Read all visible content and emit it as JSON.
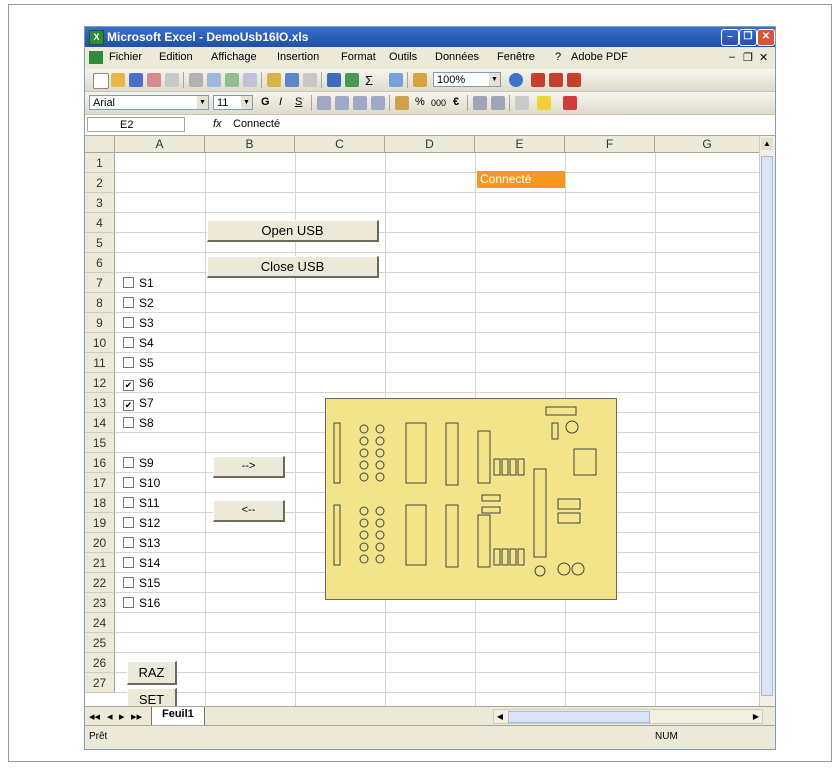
{
  "window": {
    "title": "Microsoft Excel - DemoUsb16IO.xls",
    "app_icon": "X"
  },
  "window_controls": {
    "minimize": "–",
    "restore": "❐",
    "close": "✕"
  },
  "menu": {
    "items": [
      "Fichier",
      "Edition",
      "Affichage",
      "Insertion",
      "Format",
      "Outils",
      "Données",
      "Fenêtre",
      "?",
      "Adobe PDF"
    ],
    "doc_minimize": "–",
    "doc_restore": "❐",
    "doc_close": "✕"
  },
  "toolbar": {
    "zoom": "100%",
    "sigma": "Σ"
  },
  "format_toolbar": {
    "font": "Arial",
    "size": "11",
    "bold": "G",
    "italic": "I",
    "underline": "S",
    "percent": "%",
    "thousands": "000",
    "euro": "€"
  },
  "formula_bar": {
    "name_box": "E2",
    "fx": "fx",
    "value": "Connecté"
  },
  "sheet": {
    "columns": [
      "A",
      "B",
      "C",
      "D",
      "E",
      "F",
      "G"
    ],
    "rows": [
      "1",
      "2",
      "3",
      "4",
      "5",
      "6",
      "7",
      "8",
      "9",
      "10",
      "11",
      "12",
      "13",
      "14",
      "15",
      "16",
      "17",
      "18",
      "19",
      "20",
      "21",
      "22",
      "23",
      "24",
      "25",
      "26",
      "27"
    ],
    "status_cell": "Connecté",
    "status_color": "#f39a1e"
  },
  "buttons": {
    "open_usb": "Open USB",
    "close_usb": "Close USB",
    "to_right": "-->",
    "to_left": "<--",
    "raz": "RAZ",
    "set": "SET"
  },
  "checkboxes": [
    {
      "label": "S1",
      "checked": false
    },
    {
      "label": "S2",
      "checked": false
    },
    {
      "label": "S3",
      "checked": false
    },
    {
      "label": "S4",
      "checked": false
    },
    {
      "label": "S5",
      "checked": false
    },
    {
      "label": "S6",
      "checked": true
    },
    {
      "label": "S7",
      "checked": true
    },
    {
      "label": "S8",
      "checked": false
    },
    {
      "label": "S9",
      "checked": false
    },
    {
      "label": "S10",
      "checked": false
    },
    {
      "label": "S11",
      "checked": false
    },
    {
      "label": "S12",
      "checked": false
    },
    {
      "label": "S13",
      "checked": false
    },
    {
      "label": "S14",
      "checked": false
    },
    {
      "label": "S15",
      "checked": false
    },
    {
      "label": "S16",
      "checked": false
    }
  ],
  "sheet_tabs": {
    "nav": [
      "◂◂",
      "◂",
      "▸",
      "▸▸"
    ],
    "active": "Feuil1"
  },
  "status": {
    "left": "Prêt",
    "right": "NUM"
  },
  "colors": {
    "pcb_background": "#f2e489",
    "title_bar": "#2458b8"
  }
}
